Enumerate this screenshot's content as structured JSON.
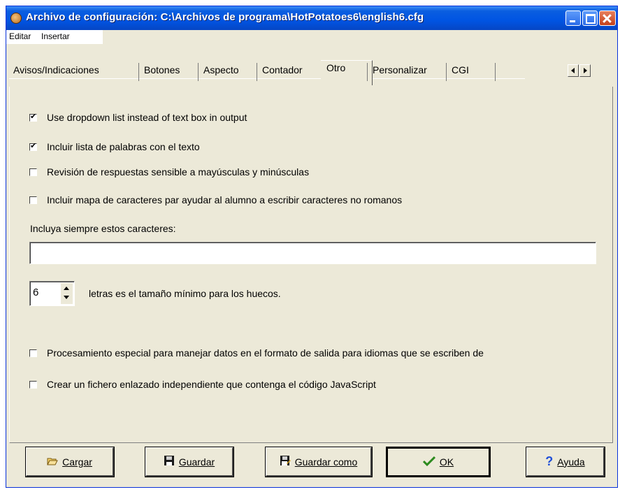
{
  "window": {
    "title": "Archivo de configuración: C:\\Archivos de programa\\HotPotatoes6\\english6.cfg"
  },
  "menu": {
    "items": [
      {
        "label": "Editar"
      },
      {
        "label": "Insertar"
      }
    ]
  },
  "tabs": [
    {
      "label": "Avisos/Indicaciones",
      "active": false
    },
    {
      "label": "Botones",
      "active": false
    },
    {
      "label": "Aspecto",
      "active": false
    },
    {
      "label": "Contador",
      "active": false
    },
    {
      "label": "Otro",
      "active": true
    },
    {
      "label": "Personalizar",
      "active": false
    },
    {
      "label": "CGI",
      "active": false
    }
  ],
  "options": [
    {
      "label": "Use dropdown list instead of text box in output",
      "checked": true
    },
    {
      "label": "Incluir lista de palabras con el texto",
      "checked": true
    },
    {
      "label": "Revisión de respuestas sensible a mayúsculas y minúsculas",
      "checked": false
    },
    {
      "label": "Incluir mapa de caracteres par ayudar al alumno a escribir caracteres no romanos",
      "checked": false
    }
  ],
  "chars": {
    "label": "Incluya siempre estos caracteres:",
    "value": ""
  },
  "gap": {
    "value": "6",
    "label": "letras es el tamaño mínimo para los huecos."
  },
  "options2": [
    {
      "label": "Procesamiento especial para manejar datos en el formato de salida para idiomas que se escriben de",
      "checked": false
    },
    {
      "label": "Crear un fichero enlazado independiente que contenga el código JavaScript",
      "checked": false
    }
  ],
  "buttons": {
    "cargar": {
      "label": "Cargar",
      "icon": "folder-open-icon"
    },
    "guardar": {
      "label": "Guardar",
      "icon": "floppy-disk-icon"
    },
    "guardar_como": {
      "label": "Guardar como",
      "icon": "floppy-disk-pencil-icon"
    },
    "ok": {
      "label": "OK",
      "icon": "checkmark-icon"
    },
    "ayuda": {
      "label": "Ayuda",
      "icon": "question-mark-icon"
    }
  }
}
